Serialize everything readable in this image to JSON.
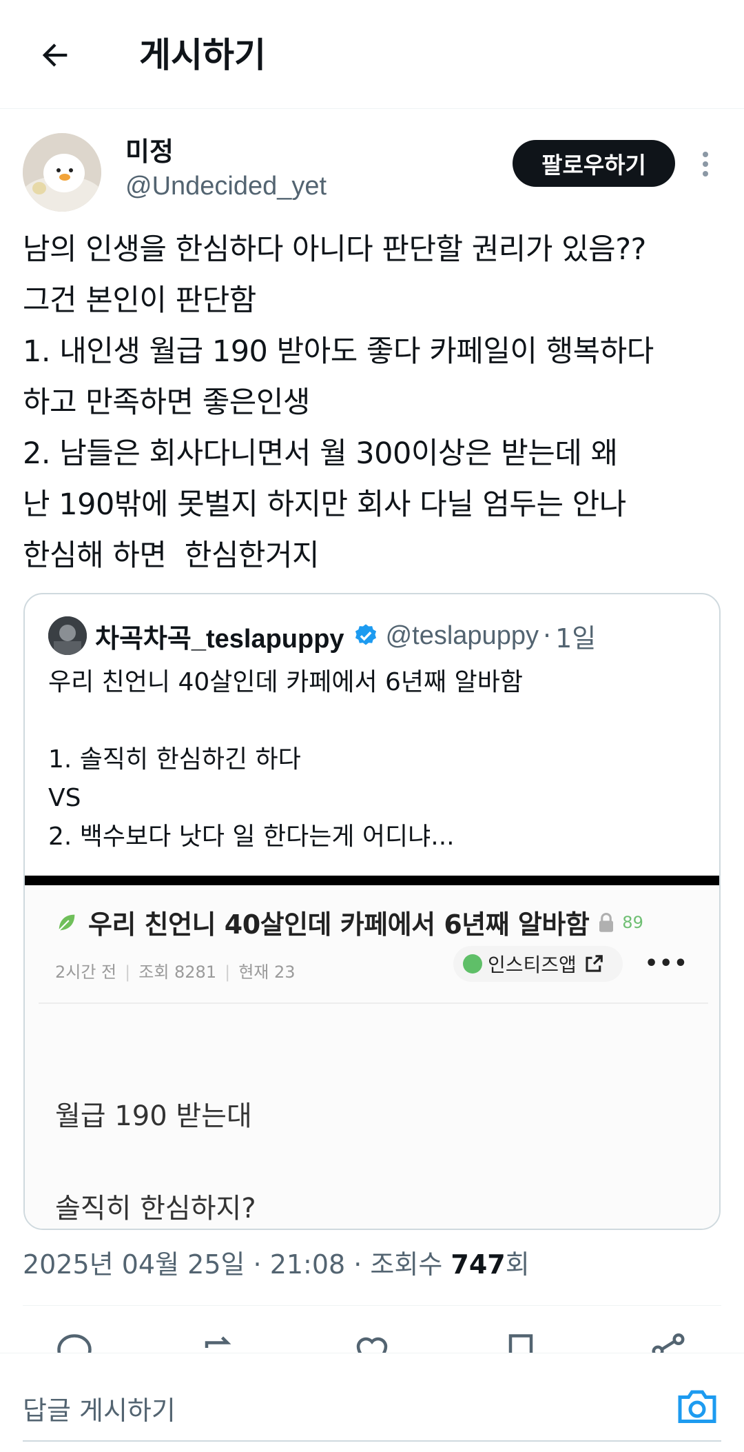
{
  "header": {
    "title": "게시하기"
  },
  "post": {
    "author_name": "미정",
    "author_handle": "@Undecided_yet",
    "follow_label": "팔로우하기",
    "text": "남의 인생을 한심하다 아니다 판단할 권리가 있음??\n그건 본인이 판단함\n1. 내인생 월급 190 받아도 좋다 카페일이 행복하다\n하고 만족하면 좋은인생\n2. 남들은 회사다니면서 월 300이상은 받는데 왜\n난 190밖에 못벌지 하지만 회사 다닐 엄두는 안나\n한심해 하면  한심한거지",
    "date": "2025년 04월 25일 · 21:08 · 조회수 ",
    "views": "747",
    "views_suffix": "회"
  },
  "quote": {
    "name": "차곡차곡_teslapuppy",
    "handle": "@teslapuppy",
    "time": "1일",
    "text": "우리 친언니 40살인데 카페에서 6년째 알바함\n\n1. 솔직히 한심하긴 하다\nVS\n2. 백수보다 낫다 일 한다는게 어디냐...",
    "image": {
      "title": "우리 친언니 40살인데 카페에서 6년째 알바함",
      "count": "89",
      "meta_time": "2시간 전",
      "meta_views": "조회 8281",
      "meta_now": "현재 23",
      "app_label": "인스티즈앱",
      "body_line1": "월급 190 받는대",
      "body_line2": "솔직히 한심하지?"
    }
  },
  "reply": {
    "placeholder": "답글 게시하기"
  },
  "colors": {
    "accent": "#1d9bf0",
    "muted": "#536471",
    "text": "#0f1419"
  },
  "icons": [
    "back-arrow-icon",
    "more-vertical-icon",
    "verified-badge-icon",
    "reply-icon",
    "repost-icon",
    "like-icon",
    "bookmark-icon",
    "share-icon",
    "camera-icon"
  ]
}
